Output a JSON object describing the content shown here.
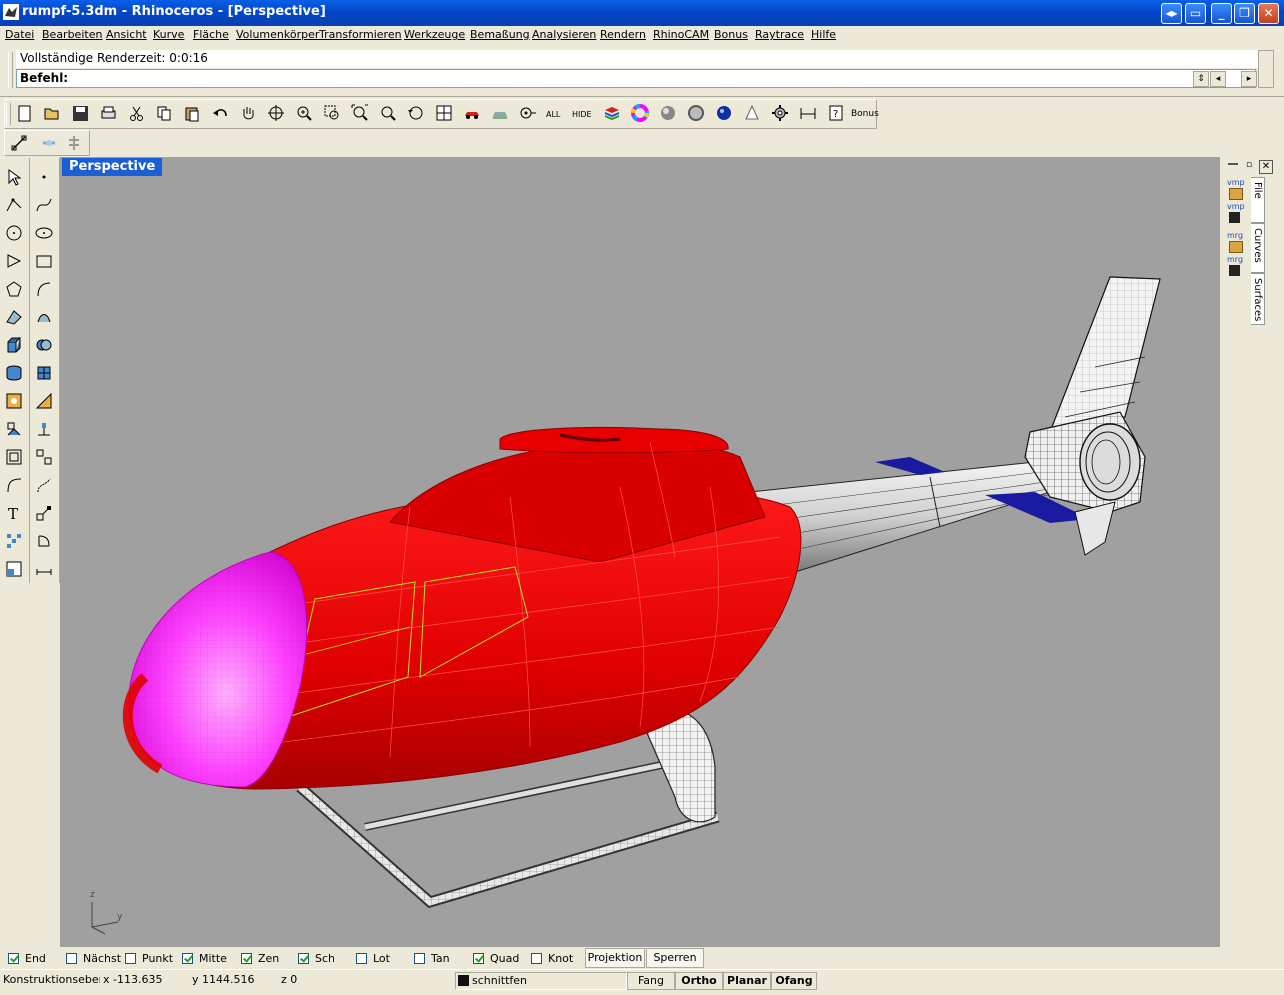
{
  "window": {
    "title": "rumpf-5.3dm - Rhinoceros - [Perspective]",
    "buttons": [
      "help-layout",
      "restore-other",
      "minimize",
      "maximize",
      "close"
    ]
  },
  "menu": [
    {
      "label": "Datei"
    },
    {
      "label": "Bearbeiten"
    },
    {
      "label": "Ansicht"
    },
    {
      "label": "Kurve"
    },
    {
      "label": "Fläche"
    },
    {
      "label": "Volumenkörper"
    },
    {
      "label": "Transformieren"
    },
    {
      "label": "Werkzeuge"
    },
    {
      "label": "Bemaßung"
    },
    {
      "label": "Analysieren"
    },
    {
      "label": "Rendern"
    },
    {
      "label": "RhinoCAM"
    },
    {
      "label": "Bonus"
    },
    {
      "label": "Raytrace"
    },
    {
      "label": "Hilfe"
    }
  ],
  "command": {
    "history": "Vollständige Renderzeit: 0:0:16",
    "prompt_label": "Befehl:",
    "input_value": ""
  },
  "toolbar_main": {
    "all_label": "ALL",
    "hide_label": "HIDE",
    "bonus_label": "Bonus"
  },
  "viewport": {
    "label": "Perspective",
    "axis_z": "z",
    "axis_y": "y"
  },
  "right_panel": {
    "tabs": [
      "File",
      "Curves",
      "Surfaces"
    ],
    "items": [
      "vmp",
      "vmp",
      "mrg",
      "mrg"
    ]
  },
  "osnaps": [
    {
      "label": "End",
      "checked": true
    },
    {
      "label": "Nächst",
      "checked": false
    },
    {
      "label": "Punkt",
      "checked": false
    },
    {
      "label": "Mitte",
      "checked": true
    },
    {
      "label": "Zen",
      "checked": true
    },
    {
      "label": "Sch",
      "checked": true
    },
    {
      "label": "Lot",
      "checked": false
    },
    {
      "label": "Tan",
      "checked": false
    },
    {
      "label": "Quad",
      "checked": true
    },
    {
      "label": "Knot",
      "checked": false
    }
  ],
  "osnap_buttons": {
    "projektion": "Projektion",
    "sperren": "Sperren"
  },
  "status": {
    "cplane": "Konstruktionsebene",
    "x": "x -113.635",
    "y": "y 1144.516",
    "z": "z 0",
    "layer": "schnittfen",
    "fang": "Fang",
    "ortho": "Ortho",
    "planar": "Planar",
    "ofang": "Ofang"
  },
  "colors": {
    "titlebar": "#0a5fe8",
    "viewport_bg": "#a0a0a0",
    "fuselage": "#e00000",
    "nose": "#ff00ff",
    "tail_stabilizer": "#1a1aa0",
    "viewport_label": "#1b5fd6"
  }
}
